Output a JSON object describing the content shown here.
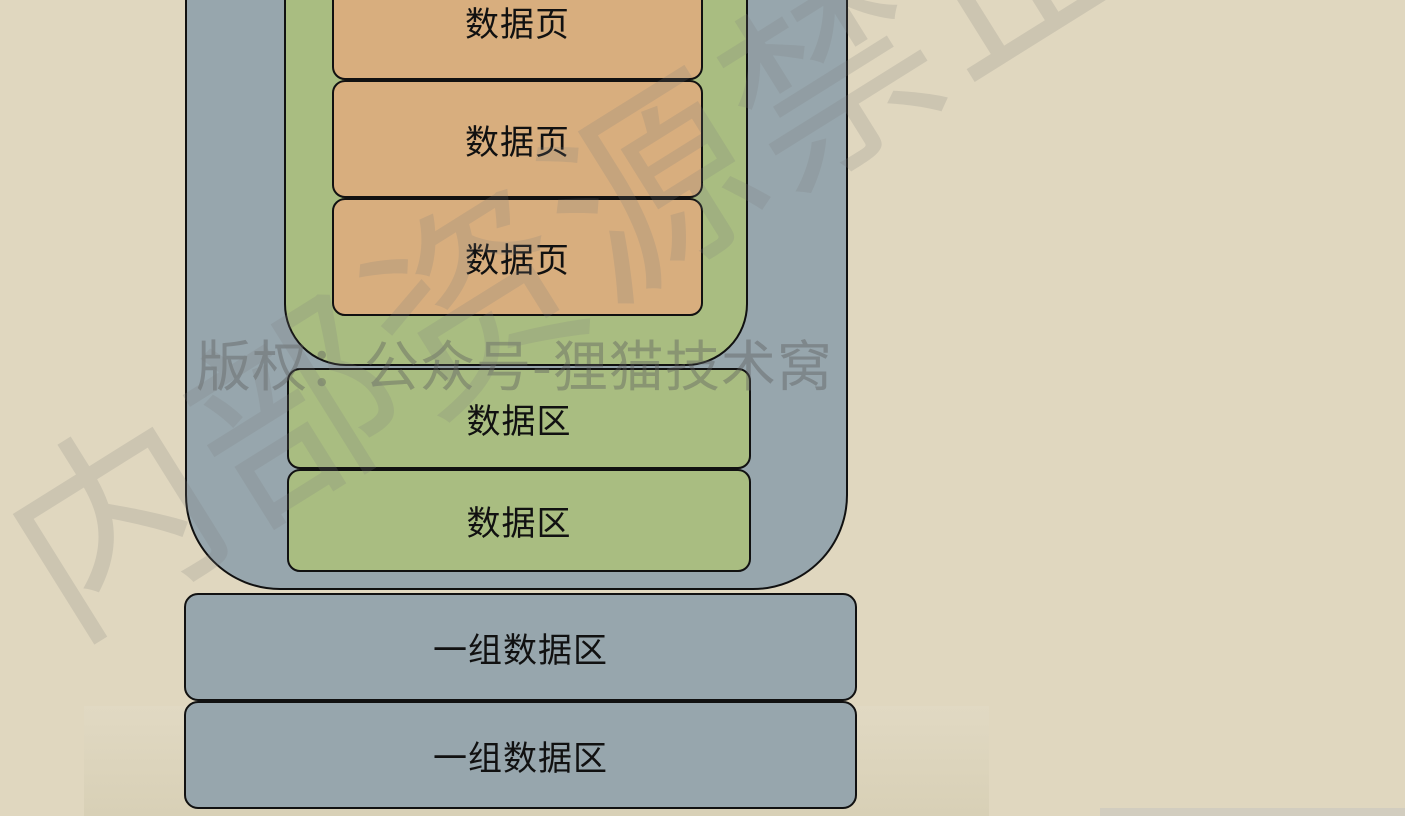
{
  "diagram": {
    "data_pages": [
      "数据页",
      "数据页",
      "数据页"
    ],
    "extents": [
      "数据区",
      "数据区"
    ],
    "extent_groups": [
      "一组数据区",
      "一组数据区"
    ]
  },
  "watermarks": {
    "copyright": "版权：公众号-狸猫技术窝",
    "diagonal": "内部资源禁止外传"
  },
  "colors": {
    "background": "#e0d7bf",
    "tablespace": "#97a6ad",
    "extent": "#a9bd81",
    "data_page": "#d8ae7e",
    "border": "#111111"
  }
}
